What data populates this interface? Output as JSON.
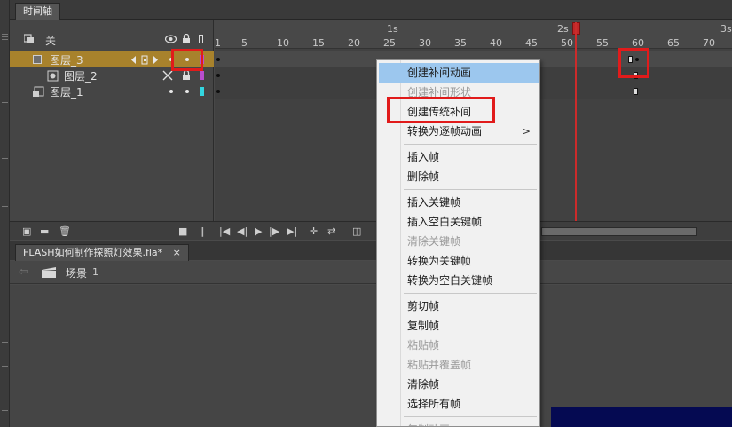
{
  "timeline_tab": "时间轴",
  "layer_header": {
    "label": "关",
    "eye_icon": "eye-icon",
    "lock_icon": "lock-icon"
  },
  "layers": [
    {
      "name": "图层_3",
      "selected": true,
      "color": "#b84ecf"
    },
    {
      "name": "图层_2",
      "selected": false,
      "color": "#b84ecf"
    },
    {
      "name": "图层_1",
      "selected": false,
      "color": "#33d6e0"
    }
  ],
  "ruler": {
    "frame_numbers": [
      "1",
      "5",
      "10",
      "15",
      "20",
      "25",
      "30",
      "35",
      "40",
      "45",
      "50",
      "55",
      "60",
      "65",
      "70"
    ],
    "seconds": [
      "1s",
      "2s",
      "3s"
    ]
  },
  "doc_tab": {
    "title": "FLASH如何制作探照灯效果.fla*",
    "close": "×"
  },
  "breadcrumb": {
    "scene_label": "场景",
    "scene_number": "1"
  },
  "context_menu": {
    "items": [
      {
        "label": "创建补间动画",
        "enabled": true,
        "highlighted": true
      },
      {
        "label": "创建补间形状",
        "enabled": false
      },
      {
        "label": "创建传统补间",
        "enabled": true
      },
      {
        "label": "转换为逐帧动画",
        "enabled": true,
        "submenu": ">"
      },
      {
        "label": "插入帧",
        "enabled": true
      },
      {
        "label": "删除帧",
        "enabled": true
      },
      {
        "label": "插入关键帧",
        "enabled": true
      },
      {
        "label": "插入空白关键帧",
        "enabled": true
      },
      {
        "label": "清除关键帧",
        "enabled": false
      },
      {
        "label": "转换为关键帧",
        "enabled": true
      },
      {
        "label": "转换为空白关键帧",
        "enabled": true
      },
      {
        "label": "剪切帧",
        "enabled": true
      },
      {
        "label": "复制帧",
        "enabled": true
      },
      {
        "label": "粘贴帧",
        "enabled": false
      },
      {
        "label": "粘贴并覆盖帧",
        "enabled": false
      },
      {
        "label": "清除帧",
        "enabled": true
      },
      {
        "label": "选择所有帧",
        "enabled": true
      },
      {
        "label": "复制动画",
        "enabled": false
      }
    ]
  },
  "colors": {
    "highlight_box": "#e11b1b",
    "selected_layer": "#a8822c",
    "menu_hover": "#9cc7ee",
    "playhead": "#cc2b2b"
  }
}
